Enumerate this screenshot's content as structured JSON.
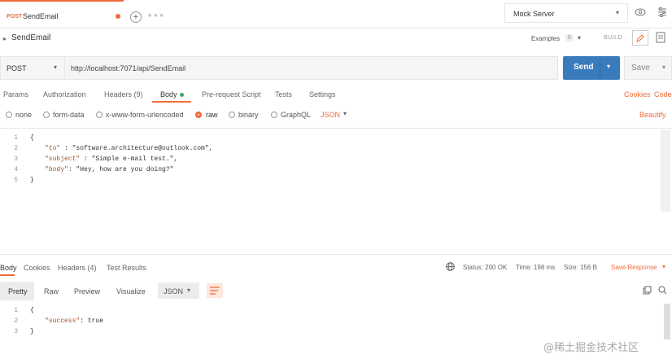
{
  "tab": {
    "method": "POST",
    "name": "SendEmail"
  },
  "mock_server": {
    "label": "Mock Server"
  },
  "request": {
    "title": "SendEmail",
    "examples_label": "Examples",
    "examples_count": "0",
    "build_label": "BUILD",
    "method": "POST",
    "url": "http://localhost:7071/api/SendEmail",
    "send_label": "Send",
    "save_label": "Save"
  },
  "request_tabs": [
    {
      "label": "Params"
    },
    {
      "label": "Authorization"
    },
    {
      "label": "Headers (9)"
    },
    {
      "label": "Body"
    },
    {
      "label": "Pre-request Script"
    },
    {
      "label": "Tests"
    },
    {
      "label": "Settings"
    }
  ],
  "request_tabs_right": {
    "cookies": "Cookies",
    "code": "Code"
  },
  "body_types": [
    {
      "label": "none"
    },
    {
      "label": "form-data"
    },
    {
      "label": "x-www-form-urlencoded"
    },
    {
      "label": "raw"
    },
    {
      "label": "binary"
    },
    {
      "label": "GraphQL"
    }
  ],
  "body_format": "JSON",
  "beautify_label": "Beautify",
  "request_body": {
    "line_numbers": [
      "1",
      "2",
      "3",
      "4",
      "5"
    ],
    "lines": [
      {
        "key": "{",
        "value": ""
      },
      {
        "key": "\"to\"",
        "value": " : \"software.architecture@outlook.com\","
      },
      {
        "key": "\"subject\"",
        "value": " : \"Simple e-mail test.\","
      },
      {
        "key": "\"body\"",
        "value": ": \"Hey, how are you doing?\""
      },
      {
        "key": "}",
        "value": ""
      }
    ]
  },
  "response_tabs": [
    {
      "label": "Body"
    },
    {
      "label": "Cookies"
    },
    {
      "label": "Headers (4)"
    },
    {
      "label": "Test Results"
    }
  ],
  "response_status": {
    "status": "Status: 200 OK",
    "time": "Time: 198 ms",
    "size": "Size: 156 B",
    "save_response": "Save Response"
  },
  "response_views": [
    {
      "label": "Pretty"
    },
    {
      "label": "Raw"
    },
    {
      "label": "Preview"
    },
    {
      "label": "Visualize"
    }
  ],
  "response_format": "JSON",
  "response_body": {
    "line_numbers": [
      "1",
      "2",
      "3"
    ],
    "lines": [
      {
        "key": "{",
        "value": ""
      },
      {
        "key": "\"success\"",
        "value": ": true"
      },
      {
        "key": "}",
        "value": ""
      }
    ]
  },
  "watermark": "@稀土掘金技术社区",
  "colors": {
    "accent": "#f26b3a",
    "send_blue": "#3a7bbd"
  }
}
